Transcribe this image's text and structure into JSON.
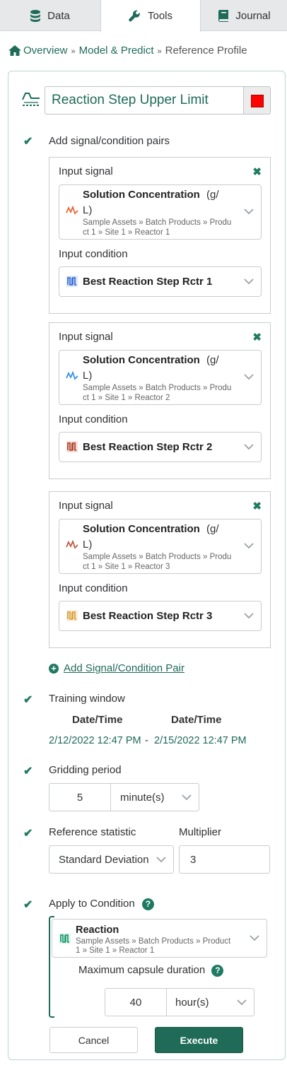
{
  "tabs": [
    {
      "label": "Data",
      "icon": "database-icon"
    },
    {
      "label": "Tools",
      "icon": "wrench-icon"
    },
    {
      "label": "Journal",
      "icon": "book-icon"
    }
  ],
  "breadcrumb": {
    "overview": "Overview",
    "model": "Model & Predict",
    "current": "Reference Profile",
    "sep": "»"
  },
  "tool": {
    "name": "Reaction Step Upper Limit",
    "color": "#ff0000"
  },
  "pairs_section": {
    "label": "Add signal/condition pairs",
    "signal_label": "Input signal",
    "condition_label": "Input condition",
    "remove_glyph": "✖",
    "pairs": [
      {
        "signal_name": "Solution Concentration",
        "signal_unit": "(g/",
        "signal_unit2": "L)",
        "signal_path": "Sample Assets » Batch Products » Product 1 » Site 1 » Reactor 1",
        "signal_color": "#e8612c",
        "condition_name": "Best Reaction Step Rctr 1",
        "condition_color": "#3a6fd8"
      },
      {
        "signal_name": "Solution Concentration",
        "signal_unit": "(g/",
        "signal_unit2": "L)",
        "signal_path": "Sample Assets » Batch Products » Product 1 » Site 1 » Reactor 2",
        "signal_color": "#2f8de4",
        "condition_name": "Best Reaction Step Rctr 2",
        "condition_color": "#b5452a"
      },
      {
        "signal_name": "Solution Concentration",
        "signal_unit": "(g/",
        "signal_unit2": "L)",
        "signal_path": "Sample Assets » Batch Products » Product 1 » Site 1 » Reactor 3",
        "signal_color": "#c0533a",
        "condition_name": "Best Reaction Step Rctr 3",
        "condition_color": "#d9a23a"
      }
    ],
    "add_pair_label": "Add Signal/Condition Pair"
  },
  "training_window": {
    "label": "Training window",
    "start_head": "Date/Time",
    "end_head": "Date/Time",
    "start": "2/12/2022 12:47 PM",
    "dash": "-",
    "end": "2/15/2022 12:47 PM"
  },
  "gridding": {
    "label": "Gridding period",
    "value": "5",
    "unit": "minute(s)"
  },
  "statistic": {
    "label": "Reference statistic",
    "value": "Standard Deviation",
    "multiplier_label": "Multiplier",
    "multiplier": "3"
  },
  "apply_condition": {
    "label": "Apply to Condition",
    "help": "?",
    "name": "Reaction",
    "path": "Sample Assets » Batch Products » Product 1 » Site 1 » Reactor 1",
    "color": "#1f9e6e",
    "max_duration_label": "Maximum capsule duration",
    "max_duration_value": "40",
    "max_duration_unit": "hour(s)"
  },
  "buttons": {
    "cancel": "Cancel",
    "execute": "Execute"
  }
}
